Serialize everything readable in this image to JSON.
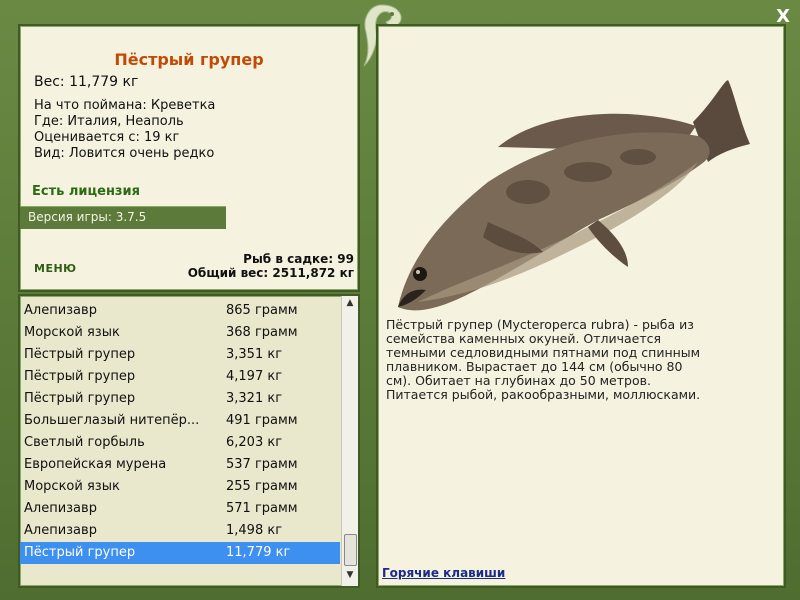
{
  "fish": {
    "name": "Пёстрый групер",
    "weight": "Вес: 11,779 кг",
    "bait": "На что поймана: Креветка",
    "location": "Где: Италия, Неаполь",
    "valued": "Оценивается с: 19 кг",
    "rarity": "Вид: Ловится очень редко"
  },
  "license": "Есть лицензия",
  "version": "Версия игры: 3.7.5",
  "menu_label": "МЕНЮ",
  "stats": {
    "fish_count": "Рыб в садке: 99",
    "total_weight": "Общий вес: 2511,872 кг"
  },
  "catch_list": [
    {
      "name": "Алепизавр",
      "weight": "865 грамм"
    },
    {
      "name": "Морской язык",
      "weight": "368 грамм"
    },
    {
      "name": "Пёстрый групер",
      "weight": "3,351 кг"
    },
    {
      "name": "Пёстрый групер",
      "weight": "4,197 кг"
    },
    {
      "name": "Пёстрый групер",
      "weight": "3,321 кг"
    },
    {
      "name": "Большеглазый нитепёр...",
      "weight": "491 грамм"
    },
    {
      "name": "Светлый горбыль",
      "weight": "6,203 кг"
    },
    {
      "name": "Европейская мурена",
      "weight": "537 грамм"
    },
    {
      "name": "Морской язык",
      "weight": "255 грамм"
    },
    {
      "name": "Алепизавр",
      "weight": "571 грамм"
    },
    {
      "name": "Алепизавр",
      "weight": "1,498 кг"
    },
    {
      "name": "Пёстрый групер",
      "weight": "11,779 кг"
    }
  ],
  "description": "Пёстрый групер (Mycteroperca rubra) - рыба из семейства каменных окуней. Отличается темными седловидными пятнами под спинным плавником. Вырастает до 144 см (обычно 80 см). Обитает на глубинах до 50 метров. Питается рыбой, ракообразными, моллюсками.",
  "hotkeys": "Горячие клавиши",
  "close_glyph": "X",
  "colors": {
    "accent": "#c24a07",
    "license": "#2c6a14",
    "selection": "#3d8ff0",
    "frame": "#5c7a3a"
  }
}
